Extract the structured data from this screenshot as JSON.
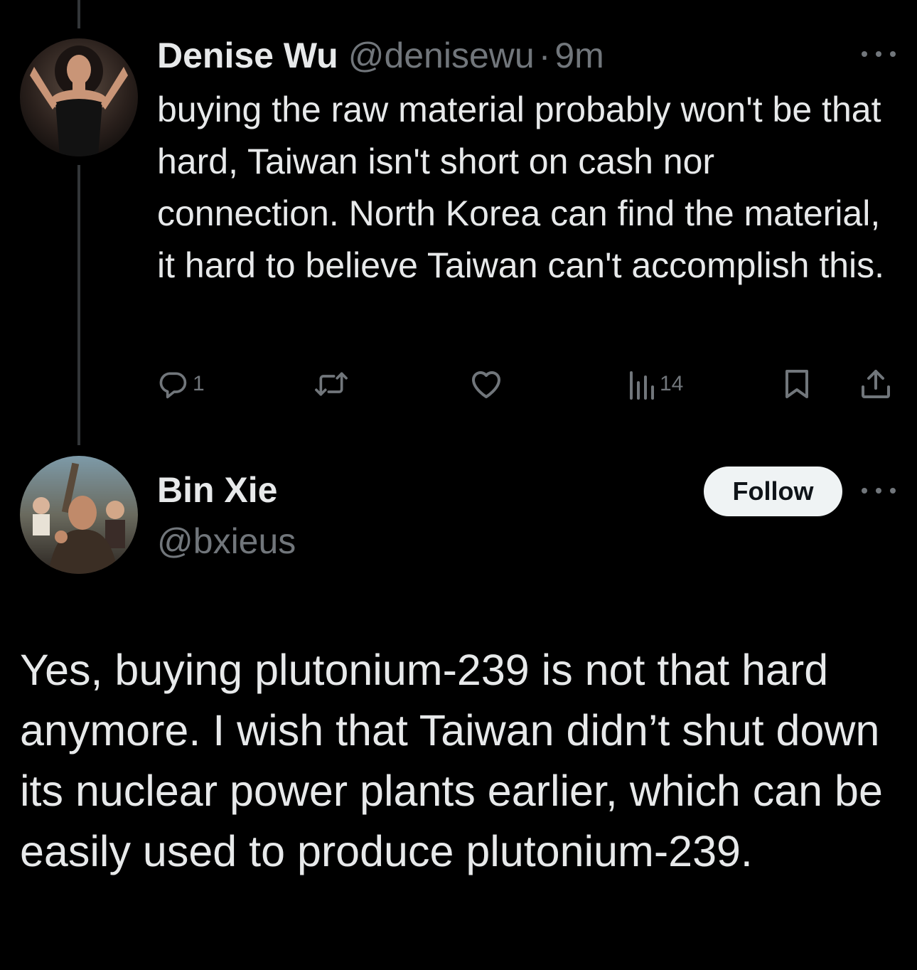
{
  "colors": {
    "background": "#000000",
    "primary_text": "#e7e9ea",
    "secondary_text": "#71767b",
    "thread_line": "#333639",
    "follow_button_bg": "#eff3f4",
    "follow_button_text": "#0f1419"
  },
  "parent_tweet": {
    "display_name": "Denise Wu",
    "handle": "@denisewu",
    "separator": "·",
    "time": "9m",
    "avatar_icon": "user-avatar-photo",
    "text": "buying the raw material probably won't be that hard, Taiwan isn't short on cash nor connection. North Korea can find the material, it hard to believe Taiwan can't accomplish this.",
    "actions": {
      "reply": {
        "icon": "reply-icon",
        "count": "1"
      },
      "retweet": {
        "icon": "retweet-icon",
        "count": ""
      },
      "like": {
        "icon": "heart-icon",
        "count": ""
      },
      "views": {
        "icon": "views-icon",
        "count": "14"
      },
      "bookmark": {
        "icon": "bookmark-icon"
      },
      "share": {
        "icon": "share-icon"
      }
    },
    "more_icon": "more-icon"
  },
  "reply_tweet": {
    "display_name": "Bin Xie",
    "handle": "@bxieus",
    "avatar_icon": "user-avatar-photo",
    "follow_label": "Follow",
    "more_icon": "more-icon",
    "text": "Yes, buying plutonium-239 is not that hard anymore. I wish that Taiwan didn’t shut down its nuclear power plants earlier, which can be easily used to produce plutonium-239."
  }
}
